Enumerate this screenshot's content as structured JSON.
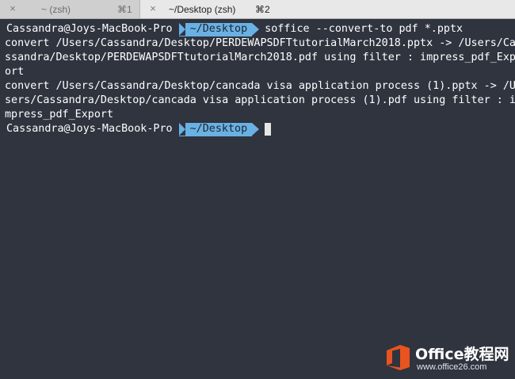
{
  "tabs": [
    {
      "title": "~ (zsh)",
      "shortcut": "⌘1",
      "close_icon": "×",
      "active": false
    },
    {
      "title": "~/Desktop (zsh)",
      "shortcut": "⌘2",
      "close_icon": "×",
      "active": true
    }
  ],
  "terminal": {
    "prompt1": {
      "userhost": "Cassandra@Joys-MacBook-Pro",
      "cwd": "~/Desktop",
      "command": "soffice --convert-to pdf *.pptx"
    },
    "output_lines": [
      "convert /Users/Cassandra/Desktop/PERDEWAPSDFTtutorialMarch2018.pptx -> /Users/Ca",
      "ssandra/Desktop/PERDEWAPSDFTtutorialMarch2018.pdf using filter : impress_pdf_Exp",
      "ort",
      "convert /Users/Cassandra/Desktop/cancada visa application process (1).pptx -> /U",
      "sers/Cassandra/Desktop/cancada visa application process (1).pdf using filter : i",
      "mpress_pdf_Export"
    ],
    "prompt2": {
      "userhost": "Cassandra@Joys-MacBook-Pro",
      "cwd": "~/Desktop",
      "command": ""
    },
    "colors": {
      "background": "#2f343f",
      "text": "#ffffff",
      "cwd_segment": "#69b1e3",
      "cursor": "#e6e6e6"
    }
  },
  "watermark": {
    "brand": "Office教程网",
    "url": "www.office26.com",
    "logo_icon": "office-logo-icon",
    "logo_color": "#e8531f"
  }
}
